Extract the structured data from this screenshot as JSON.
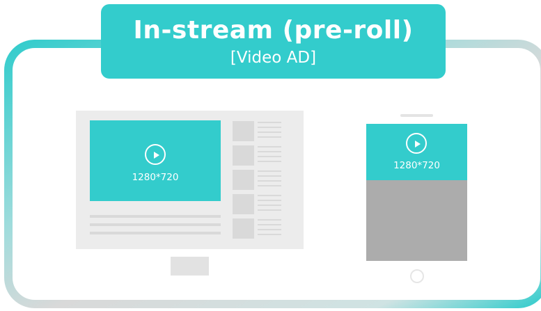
{
  "title": {
    "main": "In-stream (pre-roll)",
    "sub": "[Video AD]"
  },
  "desktop": {
    "video_resolution": "1280*720",
    "icons": [
      "play-icon"
    ]
  },
  "mobile": {
    "video_resolution": "1280*720",
    "icons": [
      "play-icon"
    ]
  },
  "colors": {
    "accent": "#33cccc",
    "frame_gradient_start": "#33cccc",
    "frame_gradient_end": "#d9d9d9",
    "device_body": "#ececec",
    "placeholder": "#d9d9d9",
    "phone_screen": "#acacac"
  }
}
